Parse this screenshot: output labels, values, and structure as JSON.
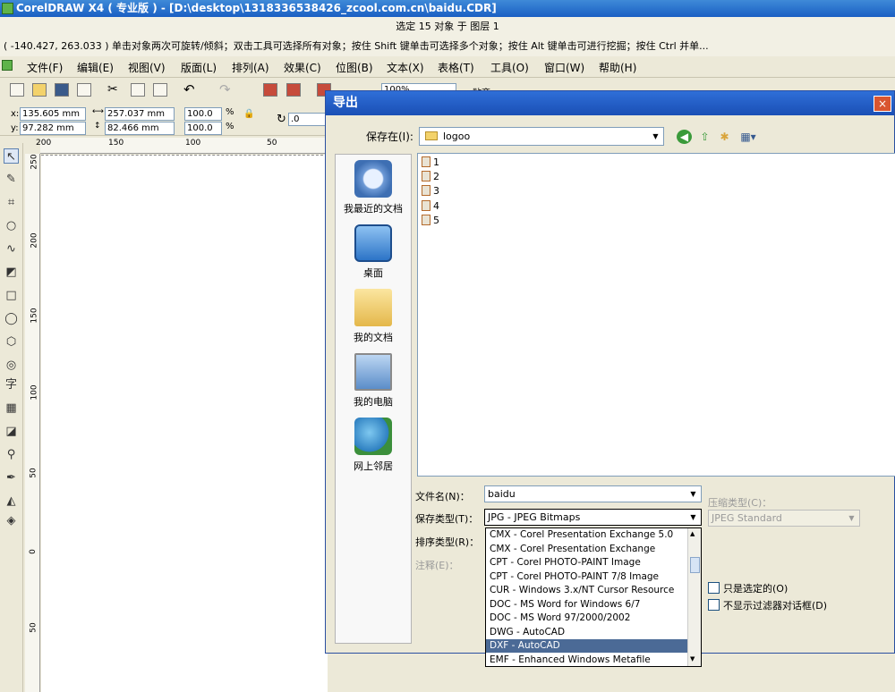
{
  "app": {
    "title": "CorelDRAW X4 ( 专业版 ) - [D:\\desktop\\1318336538426_zcool.com.cn\\baidu.CDR]",
    "selection_status": "选定 15 对象 于 图层 1",
    "hint": "( -140.427, 263.033 )    单击对象两次可旋转/倾斜；双击工具可选择所有对象；按住 Shift 键单击可选择多个对象；按住 Alt 键单击可进行挖掘；按住 Ctrl 并单..."
  },
  "menu": [
    "文件(F)",
    "编辑(E)",
    "视图(V)",
    "版面(L)",
    "排列(A)",
    "效果(C)",
    "位图(B)",
    "文本(X)",
    "表格(T)",
    "工具(O)",
    "窗口(W)",
    "帮助(H)"
  ],
  "toolbar": {
    "zoom": "100%",
    "unit_label": "贴齐"
  },
  "props": {
    "x": "135.605 mm",
    "y": "97.282 mm",
    "w": "257.037 mm",
    "h": "82.466 mm",
    "sx": "100.0",
    "sy": "100.0",
    "pct": "%",
    "angle": ".0",
    "x_label": "x:",
    "y_label": "y:"
  },
  "hruler": [
    "200",
    "150",
    "100",
    "50"
  ],
  "vruler": [
    "250",
    "200",
    "150",
    "100",
    "50",
    "0",
    "50"
  ],
  "dialog": {
    "title": "导出",
    "close": "×",
    "save_in_label": "保存在(I):",
    "save_in_value": "logoo",
    "places": [
      "我最近的文档",
      "桌面",
      "我的文档",
      "我的电脑",
      "网上邻居"
    ],
    "files": [
      "1",
      "2",
      "3",
      "4",
      "5"
    ],
    "filename_label": "文件名(N)：",
    "filename_value": "baidu",
    "savetype_label": "保存类型(T)：",
    "savetype_value": "JPG - JPEG Bitmaps",
    "sorttype_label": "排序类型(R)：",
    "notes_label": "注释(E)：",
    "compress_label": "压缩类型(C)：",
    "compress_value": "JPEG Standard",
    "selected_only": "只是选定的(O)",
    "no_filter": "不显示过滤器对话框(D)",
    "types": [
      "CMX - Corel Presentation Exchange 5.0",
      "CMX - Corel Presentation Exchange",
      "CPT - Corel PHOTO-PAINT Image",
      "CPT - Corel PHOTO-PAINT 7/8 Image",
      "CUR - Windows 3.x/NT Cursor Resource",
      "DOC - MS Word for Windows 6/7",
      "DOC - MS Word 97/2000/2002",
      "DWG - AutoCAD",
      "DXF - AutoCAD",
      "EMF - Enhanced Windows Metafile"
    ],
    "selected_type": "DXF - AutoCAD"
  }
}
